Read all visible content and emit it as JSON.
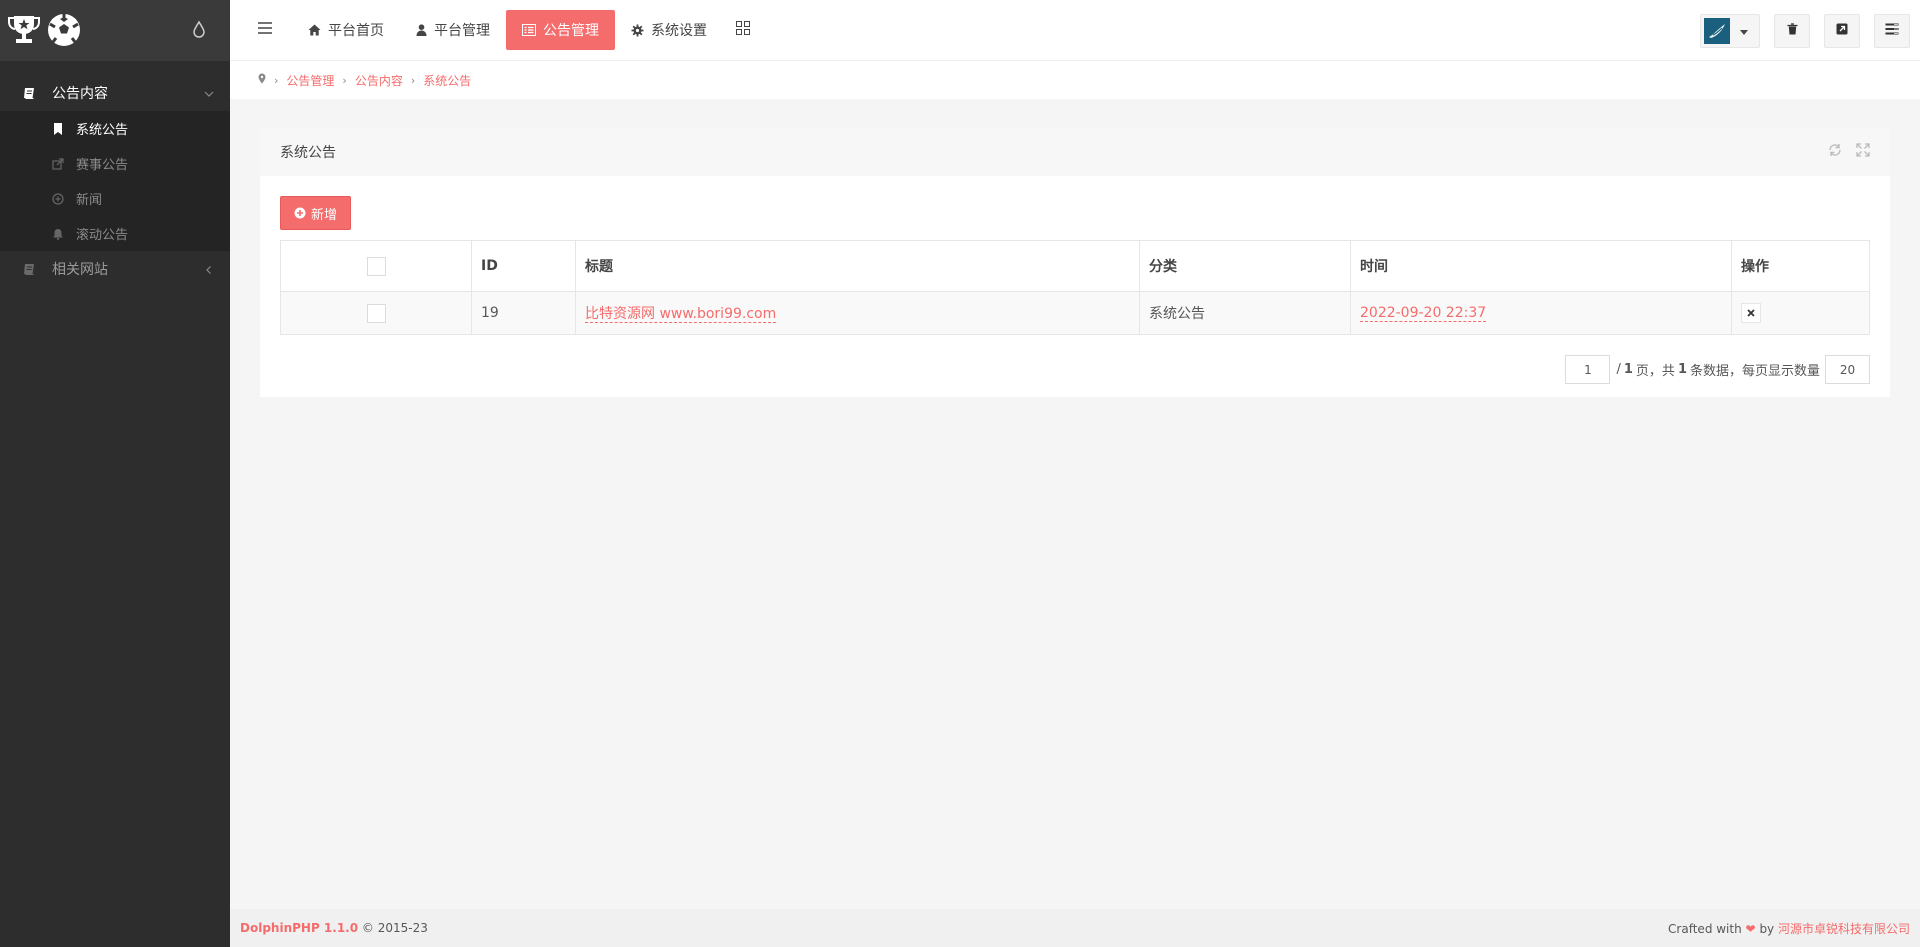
{
  "sidebar": {
    "groups": [
      {
        "label": "公告内容",
        "icon": "book-icon",
        "expanded": true,
        "items": [
          {
            "label": "系统公告",
            "icon": "bookmark-icon",
            "active": true
          },
          {
            "label": "赛事公告",
            "icon": "share-square-icon",
            "active": false
          },
          {
            "label": "新闻",
            "icon": "plus-circle-icon",
            "active": false
          },
          {
            "label": "滚动公告",
            "icon": "bell-icon",
            "active": false
          }
        ]
      },
      {
        "label": "相关网站",
        "icon": "book-icon",
        "expanded": false,
        "items": []
      }
    ]
  },
  "topbar": {
    "nav": [
      {
        "label": "平台首页",
        "icon": "home-icon",
        "active": false
      },
      {
        "label": "平台管理",
        "icon": "user-icon",
        "active": false
      },
      {
        "label": "公告管理",
        "icon": "list-alt-icon",
        "active": true
      },
      {
        "label": "系统设置",
        "icon": "gear-icon",
        "active": false
      }
    ]
  },
  "breadcrumb": [
    "公告管理",
    "公告内容",
    "系统公告"
  ],
  "panel": {
    "title": "系统公告",
    "add_label": "新增",
    "columns": [
      "ID",
      "标题",
      "分类",
      "时间",
      "操作"
    ],
    "rows": [
      {
        "id": "19",
        "title": "比特资源网 www.bori99.com",
        "category": "系统公告",
        "time": "2022-09-20 22:37"
      }
    ],
    "pager": {
      "current": "1",
      "total_pages": "1",
      "total_records": "1",
      "per_page": "20",
      "text_page": "/",
      "text_pages_suffix": "页，共",
      "text_records_suffix": "条数据，每页显示数量"
    }
  },
  "footer": {
    "brand": "DolphinPHP 1.1.0",
    "copyright": "© 2015-23",
    "crafted": "Crafted with",
    "by": "by",
    "company": "河源市卓锐科技有限公司"
  },
  "colors": {
    "accent": "#f56c6c",
    "sidebar_bg": "#2d2d2d",
    "sidebar_header_bg": "#3a3a3a"
  }
}
